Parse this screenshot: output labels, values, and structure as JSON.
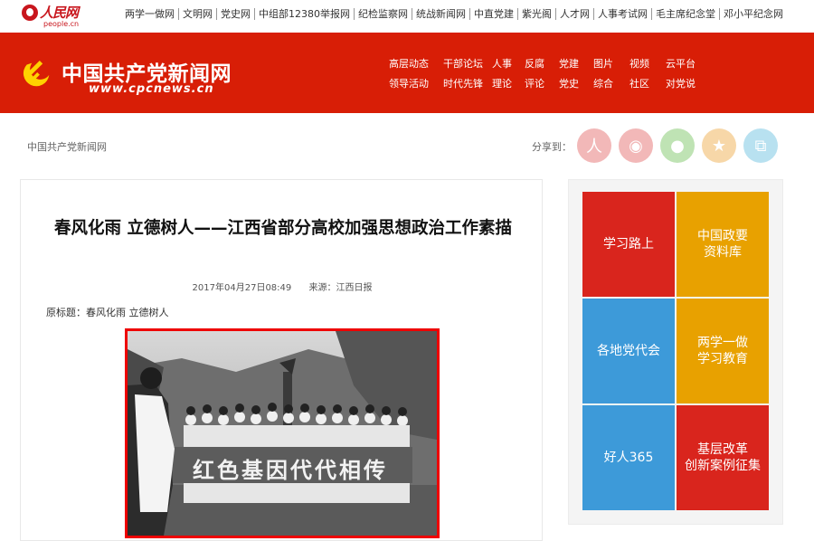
{
  "top_bar": {
    "logo_name": "人民网",
    "logo_domain": "people.cn",
    "links": [
      "两学一做网",
      "文明网",
      "党史网",
      "中组部12380举报网",
      "纪检监察网",
      "统战新闻网",
      "中直党建",
      "紫光阁",
      "人才网",
      "人事考试网",
      "毛主席纪念堂",
      "邓小平纪念网"
    ]
  },
  "header": {
    "title": "中国共产党新闻网",
    "domain": "www.cpcnews.cn",
    "nav_row1": [
      "高层动态",
      "干部论坛",
      "人事",
      "反腐",
      "党建",
      "图片",
      "视频",
      "云平台"
    ],
    "nav_row2": [
      "领导活动",
      "时代先锋",
      "理论",
      "评论",
      "党史",
      "综合",
      "社区",
      "对党说"
    ]
  },
  "breadcrumb": "中国共产党新闻网",
  "share": {
    "label": "分享到：",
    "icons": [
      {
        "name": "people-icon",
        "glyph": "人",
        "color": "#f2b8b8"
      },
      {
        "name": "weibo-icon",
        "glyph": "◉",
        "color": "#f2b8b8"
      },
      {
        "name": "wechat-icon",
        "glyph": "●",
        "color": "#bfe3b4"
      },
      {
        "name": "favorite-icon",
        "glyph": "★",
        "color": "#f7d7a8"
      },
      {
        "name": "copy-icon",
        "glyph": "⧉",
        "color": "#b8e1f0"
      }
    ]
  },
  "article": {
    "title": "春风化雨 立德树人——江西省部分高校加强思想政治工作素描",
    "date": "2017年04月27日08:49",
    "source": "来源：江西日报",
    "original_title": "原标题：春风化雨 立德树人",
    "photo_banner_text": "红色基因代代相传"
  },
  "sidebar": {
    "tiles": [
      {
        "label": "学习路上",
        "color": "#d9251d"
      },
      {
        "label": "中国政要\n资料库",
        "color": "#e8a100"
      },
      {
        "label": "各地党代会",
        "color": "#3d9ad9"
      },
      {
        "label": "两学一做\n学习教育",
        "color": "#e8a100"
      },
      {
        "label": "好人365",
        "color": "#3d9ad9"
      },
      {
        "label": "基层改革\n创新案例征集",
        "color": "#d9251d"
      }
    ]
  }
}
